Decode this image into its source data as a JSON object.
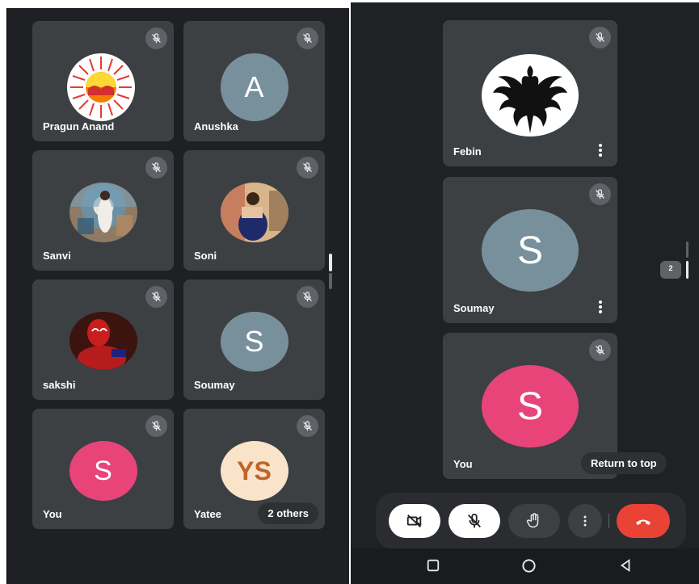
{
  "left": {
    "participants": [
      {
        "name": "Pragun Anand",
        "avatar": "image"
      },
      {
        "name": "Anushka",
        "avatar": "letter",
        "initials": "A",
        "color": "#78909c"
      },
      {
        "name": "Sanvi",
        "avatar": "image"
      },
      {
        "name": "Soni",
        "avatar": "image"
      },
      {
        "name": "sakshi",
        "avatar": "image"
      },
      {
        "name": "Soumay",
        "avatar": "letter",
        "initials": "S",
        "color": "#78909c"
      },
      {
        "name": "You",
        "avatar": "letter",
        "initials": "S",
        "color": "#e8447a"
      },
      {
        "name": "Yatee",
        "avatar": "letter",
        "initials": "YS",
        "color": "#f9e3c9",
        "text_color": "#c0632a"
      }
    ],
    "others_chip": "2 others"
  },
  "right": {
    "participants": [
      {
        "name": "Febin",
        "avatar": "image"
      },
      {
        "name": "Soumay",
        "avatar": "letter",
        "initials": "S",
        "color": "#78909c"
      },
      {
        "name": "You",
        "avatar": "letter",
        "initials": "S",
        "color": "#e8447a"
      }
    ],
    "return_to_top": "Return to top",
    "page_indicator": "2",
    "toolbar": {
      "camera": "camera-off-icon",
      "mic": "mic-off-icon",
      "raise_hand": "hand-icon",
      "more": "more-vert-icon",
      "end_call": "call-end-icon",
      "end_call_color": "#ea4335"
    }
  },
  "colors": {
    "background": "#202124",
    "tile": "#3c4043",
    "accent_pink": "#e8447a"
  }
}
